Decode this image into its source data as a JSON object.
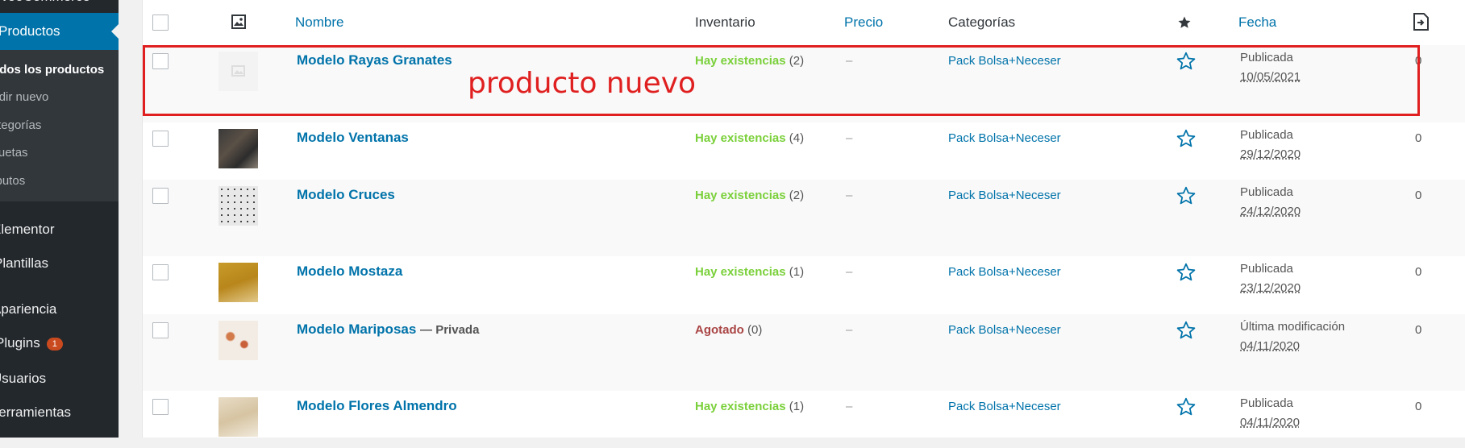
{
  "sidebar": {
    "top_label": "WooCommerce",
    "active_label": "Productos",
    "submenu": [
      {
        "label": "Todos los productos",
        "current": true
      },
      {
        "label": "Añadir nuevo",
        "current": false
      },
      {
        "label": "Categorías",
        "current": false
      },
      {
        "label": "Etiquetas",
        "current": false
      },
      {
        "label": "Atributos",
        "current": false
      }
    ],
    "items": [
      {
        "label": "Elementor"
      },
      {
        "label": "Plantillas"
      },
      {
        "label": "Apariencia"
      },
      {
        "label": "Plugins",
        "badge": "1"
      },
      {
        "label": "Usuarios"
      },
      {
        "label": "Herramientas"
      }
    ]
  },
  "table": {
    "headers": {
      "name": "Nombre",
      "stock": "Inventario",
      "price": "Precio",
      "categories": "Categorías",
      "date": "Fecha"
    },
    "rows": [
      {
        "name": "Modelo Rayas Granates",
        "state": "",
        "stock_label": "Hay existencias",
        "stock_count": "(2)",
        "in_stock": true,
        "price": "–",
        "category": "Pack Bolsa+Neceser",
        "status": "Publicada",
        "date": "10/05/2021",
        "count": "0",
        "thumb": "placeholder"
      },
      {
        "name": "Modelo Ventanas",
        "state": "",
        "stock_label": "Hay existencias",
        "stock_count": "(4)",
        "in_stock": true,
        "price": "–",
        "category": "Pack Bolsa+Neceser",
        "status": "Publicada",
        "date": "29/12/2020",
        "count": "0",
        "thumb": "dark"
      },
      {
        "name": "Modelo Cruces",
        "state": "",
        "stock_label": "Hay existencias",
        "stock_count": "(2)",
        "in_stock": true,
        "price": "–",
        "category": "Pack Bolsa+Neceser",
        "status": "Publicada",
        "date": "24/12/2020",
        "count": "0",
        "thumb": "dots"
      },
      {
        "name": "Modelo Mostaza",
        "state": "",
        "stock_label": "Hay existencias",
        "stock_count": "(1)",
        "in_stock": true,
        "price": "–",
        "category": "Pack Bolsa+Neceser",
        "status": "Publicada",
        "date": "23/12/2020",
        "count": "0",
        "thumb": "mustard"
      },
      {
        "name": "Modelo Mariposas",
        "state": "— Privada",
        "stock_label": "Agotado",
        "stock_count": "(0)",
        "in_stock": false,
        "price": "–",
        "category": "Pack Bolsa+Neceser",
        "status": "Última modificación",
        "date": "04/11/2020",
        "count": "0",
        "thumb": "butterfly"
      },
      {
        "name": "Modelo Flores Almendro",
        "state": "",
        "stock_label": "Hay existencias",
        "stock_count": "(1)",
        "in_stock": true,
        "price": "–",
        "category": "Pack Bolsa+Neceser",
        "status": "Publicada",
        "date": "04/11/2020",
        "count": "0",
        "thumb": "flowers"
      }
    ]
  },
  "annotation": {
    "note": "producto nuevo",
    "color": "#e02020"
  },
  "colors": {
    "link": "#0073aa",
    "in_stock": "#7ad03a",
    "out_of_stock": "#a44444",
    "sidebar_bg": "#23282d",
    "active_bg": "#0073aa"
  }
}
